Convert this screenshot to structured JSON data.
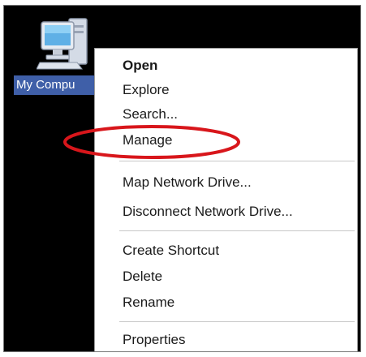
{
  "desktop": {
    "icon_label": "My Compu"
  },
  "context_menu": {
    "items": [
      {
        "label": "Open"
      },
      {
        "label": "Explore"
      },
      {
        "label": "Search..."
      },
      {
        "label": "Manage"
      },
      {
        "label": "Map Network Drive..."
      },
      {
        "label": "Disconnect Network Drive..."
      },
      {
        "label": "Create Shortcut"
      },
      {
        "label": "Delete"
      },
      {
        "label": "Rename"
      },
      {
        "label": "Properties"
      }
    ]
  },
  "colors": {
    "desktop_background": "#000000",
    "selection_highlight": "#3f5fa8",
    "annotation_ring": "#d8161b"
  },
  "icons": {
    "desktop_icon": "my-computer-icon"
  }
}
